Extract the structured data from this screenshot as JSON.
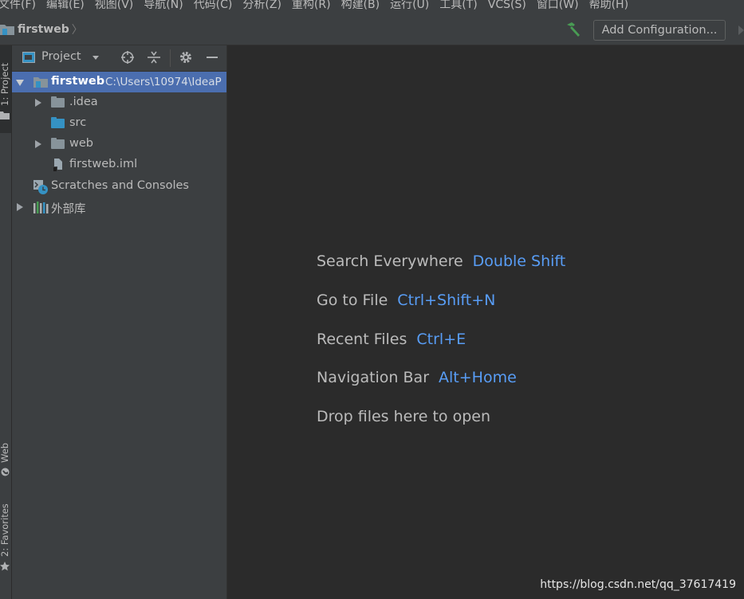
{
  "menu": [
    "文件(F)",
    "编辑(E)",
    "视图(V)",
    "导航(N)",
    "代码(C)",
    "分析(Z)",
    "重构(R)",
    "构建(B)",
    "运行(U)",
    "工具(T)",
    "VCS(S)",
    "窗口(W)",
    "帮助(H)"
  ],
  "navbar": {
    "breadcrumb": "firstweb",
    "add_configuration": "Add Configuration..."
  },
  "tool_stripe": {
    "project_tab": "1: Project",
    "web_tab": "Web",
    "favorites_tab": "2: Favorites"
  },
  "project_panel": {
    "title": "Project",
    "tree": {
      "root_name": "firstweb",
      "root_path": "C:\\Users\\10974\\IdeaP",
      "children": [
        ".idea",
        "src",
        "web",
        "firstweb.iml"
      ],
      "scratches": "Scratches and Consoles",
      "external_libs": "外部库"
    }
  },
  "editor": {
    "hints": [
      {
        "label": "Search Everywhere",
        "shortcut": "Double Shift"
      },
      {
        "label": "Go to File",
        "shortcut": "Ctrl+Shift+N"
      },
      {
        "label": "Recent Files",
        "shortcut": "Ctrl+E"
      },
      {
        "label": "Navigation Bar",
        "shortcut": "Alt+Home"
      },
      {
        "label": "Drop files here to open",
        "shortcut": ""
      }
    ]
  },
  "watermark": "https://blog.csdn.net/qq_37617419",
  "colors": {
    "background": "#2b2b2b",
    "panel": "#3c3f41",
    "selection": "#4b6eaf",
    "shortcut": "#589df6"
  }
}
